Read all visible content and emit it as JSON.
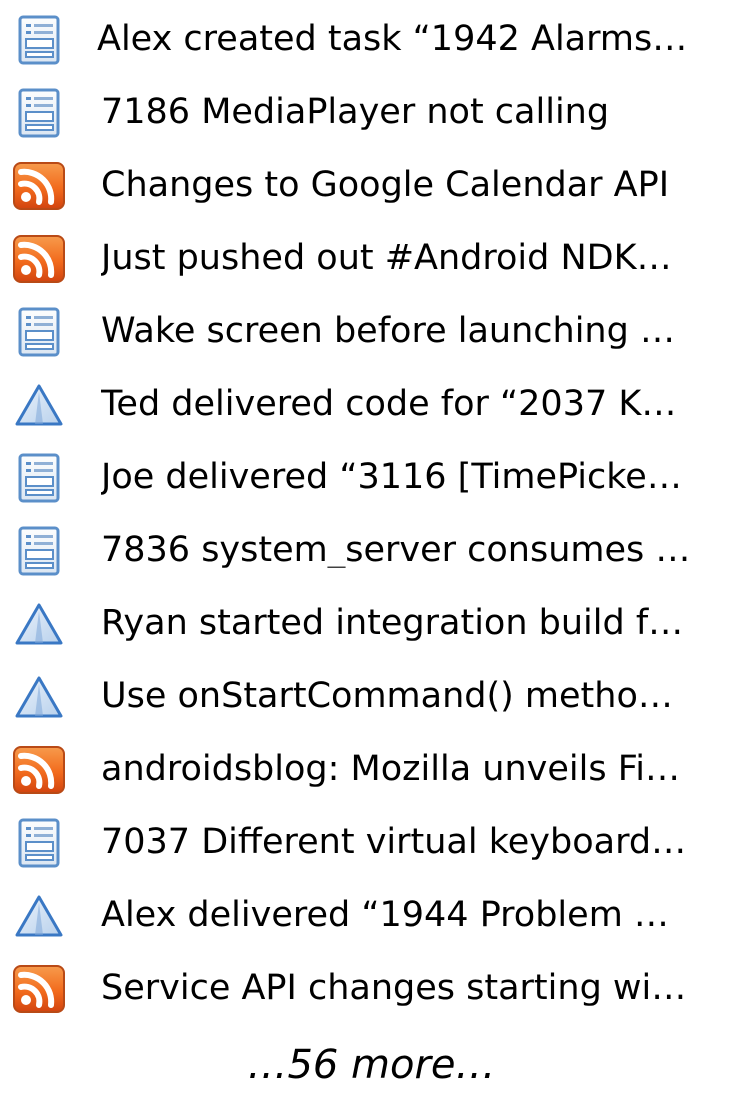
{
  "items": [
    {
      "icon": "task-form-icon",
      "text": "Alex created task “1942 Alarms…"
    },
    {
      "icon": "task-form-icon",
      "text": "7186 MediaPlayer not calling"
    },
    {
      "icon": "rss-feed-icon",
      "text": "Changes to Google Calendar API"
    },
    {
      "icon": "rss-feed-icon",
      "text": "Just pushed out #Android NDK…"
    },
    {
      "icon": "task-form-icon",
      "text": "Wake screen before launching …"
    },
    {
      "icon": "delivery-triangle-icon",
      "text": "Ted delivered code for “2037 K…"
    },
    {
      "icon": "task-form-icon",
      "text": "Joe delivered “3116 [TimePicke…"
    },
    {
      "icon": "task-form-icon",
      "text": "7836 system_server consumes …"
    },
    {
      "icon": "delivery-triangle-icon",
      "text": "Ryan started integration build f…"
    },
    {
      "icon": "delivery-triangle-icon",
      "text": "Use onStartCommand() metho…"
    },
    {
      "icon": "rss-feed-icon",
      "text": "androidsblog: Mozilla unveils Fi…"
    },
    {
      "icon": "task-form-icon",
      "text": "7037 Different virtual keyboard…"
    },
    {
      "icon": "delivery-triangle-icon",
      "text": "Alex delivered “1944 Problem …"
    },
    {
      "icon": "rss-feed-icon",
      "text": "Service API changes starting wi…"
    }
  ],
  "more_label": "…56 more…",
  "colors": {
    "rss_orange": "#f26b1d",
    "task_blue": "#5b8fc9",
    "triangle_blue": "#3a78c4"
  }
}
